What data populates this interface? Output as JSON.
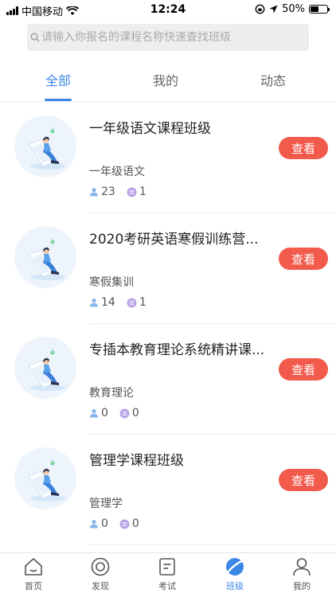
{
  "status_bar": {
    "carrier": "中国移动",
    "time": "12:24",
    "battery": "50%",
    "battery_level": 0.5
  },
  "search": {
    "placeholder": "请输入你报名的课程名称快速查找班级"
  },
  "tabs": [
    {
      "label": "全部",
      "active": true
    },
    {
      "label": "我的",
      "active": false
    },
    {
      "label": "动态",
      "active": false
    }
  ],
  "classes": [
    {
      "title": "一年级语文课程班级",
      "subtitle": "一年级语文",
      "members": "23",
      "posts": "1",
      "button": "查看"
    },
    {
      "title": "2020考研英语寒假训练营...",
      "subtitle": "寒假集训",
      "members": "14",
      "posts": "1",
      "button": "查看"
    },
    {
      "title": "专插本教育理论系统精讲课...",
      "subtitle": "教育理论",
      "members": "0",
      "posts": "0",
      "button": "查看"
    },
    {
      "title": "管理学课程班级",
      "subtitle": "管理学",
      "members": "0",
      "posts": "0",
      "button": "查看"
    }
  ],
  "bottom_nav": [
    {
      "label": "首页",
      "icon": "home-icon",
      "active": false
    },
    {
      "label": "发现",
      "icon": "discover-icon",
      "active": false
    },
    {
      "label": "考试",
      "icon": "exam-icon",
      "active": false
    },
    {
      "label": "班级",
      "icon": "class-icon",
      "active": true
    },
    {
      "label": "我的",
      "icon": "profile-icon",
      "active": false
    }
  ],
  "colors": {
    "accent": "#3d86e6",
    "button": "#f25a4c",
    "members_icon": "#8ab4ea",
    "posts_icon": "#b9a6e8"
  }
}
